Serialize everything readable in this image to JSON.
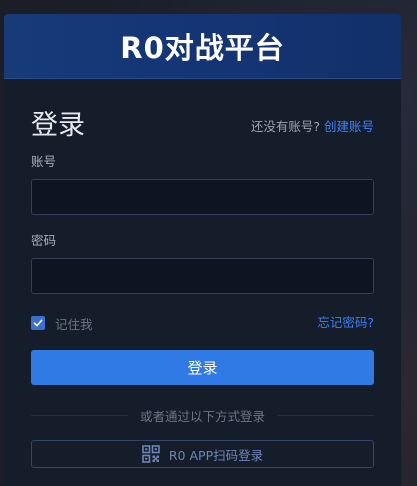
{
  "header": {
    "brand": "R0对战平台"
  },
  "login": {
    "title": "登录",
    "signup_prompt": "还没有账号?",
    "signup_link": "创建账号",
    "account_label": "账号",
    "account_value": "",
    "password_label": "密码",
    "password_value": "",
    "remember_label": "记住我",
    "remember_checked": true,
    "forgot_link": "忘记密码?",
    "submit_label": "登录"
  },
  "alt_login": {
    "divider_text": "或者通过以下方式登录",
    "qr_label": "R0 APP扫码登录",
    "qr_icon": "qr-code-icon"
  },
  "colors": {
    "header_bg": "#143575",
    "card_bg": "#151c2a",
    "accent": "#2f7ae5",
    "link": "#3b82f6"
  }
}
